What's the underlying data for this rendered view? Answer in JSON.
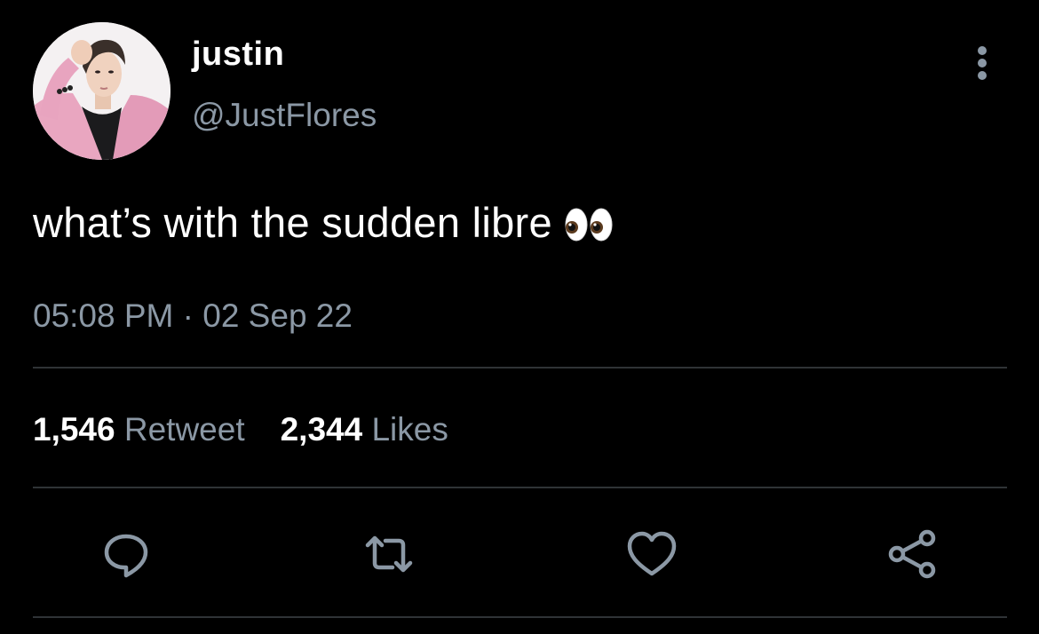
{
  "author": {
    "display_name": "justin",
    "handle": "@JustFlores",
    "avatar_icon": "profile-photo"
  },
  "tweet": {
    "text": "what’s with the sudden libre",
    "emoji_icon": "eyes-emoji",
    "timestamp": "05:08 PM · 02 Sep 22"
  },
  "stats": {
    "retweets_count": "1,546",
    "retweets_label": "Retweet",
    "likes_count": "2,344",
    "likes_label": "Likes"
  },
  "actions": {
    "reply_icon": "reply-icon",
    "retweet_icon": "retweet-icon",
    "like_icon": "heart-icon",
    "share_icon": "share-icon",
    "more_icon": "more-vertical-icon"
  },
  "colors": {
    "background": "#000000",
    "primary_text": "#ffffff",
    "secondary_text": "#8b98a5",
    "divider": "#2f3336"
  }
}
